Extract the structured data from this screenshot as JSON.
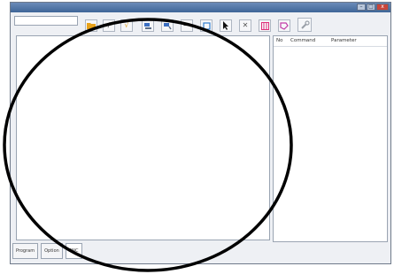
{
  "window": {
    "title": "",
    "controls": {
      "minimize": "–",
      "maximize": "□",
      "close": "x"
    }
  },
  "selector": {
    "value": ""
  },
  "toolbar": {
    "tools": [
      {
        "name": "open-folder-icon",
        "glyph": "",
        "color": "#e8a21a"
      },
      {
        "name": "edit-icon",
        "glyph": "/",
        "color": "#777777"
      },
      {
        "name": "check-icon",
        "glyph": "√",
        "color": "#e0a020"
      },
      {
        "name": "run-icon",
        "glyph": "",
        "color": "#3b6fc2"
      },
      {
        "name": "step-icon",
        "glyph": "",
        "color": "#3b6fc2"
      },
      {
        "name": "line-icon",
        "glyph": "—",
        "color": "#777777"
      },
      {
        "name": "frame-icon",
        "glyph": "",
        "color": "#2e7fd1"
      },
      {
        "name": "pointer-icon",
        "glyph": "",
        "color": "#111111"
      },
      {
        "name": "cross-icon",
        "glyph": "✕",
        "color": "#888888"
      },
      {
        "name": "grid-icon",
        "glyph": "",
        "color": "#e0307a"
      },
      {
        "name": "shape-icon",
        "glyph": "",
        "color": "#c23da8"
      },
      {
        "name": "wrench-icon",
        "glyph": "",
        "color": "#9aa0a8"
      }
    ]
  },
  "command_panel": {
    "columns": [
      "No",
      "Command",
      "Parameter"
    ]
  },
  "tabs": [
    "Program",
    "Option",
    "CNC"
  ],
  "active_tab": "CNC",
  "colors": {
    "titlebar": "#4f73a6",
    "annotation_ring": "#000000"
  }
}
